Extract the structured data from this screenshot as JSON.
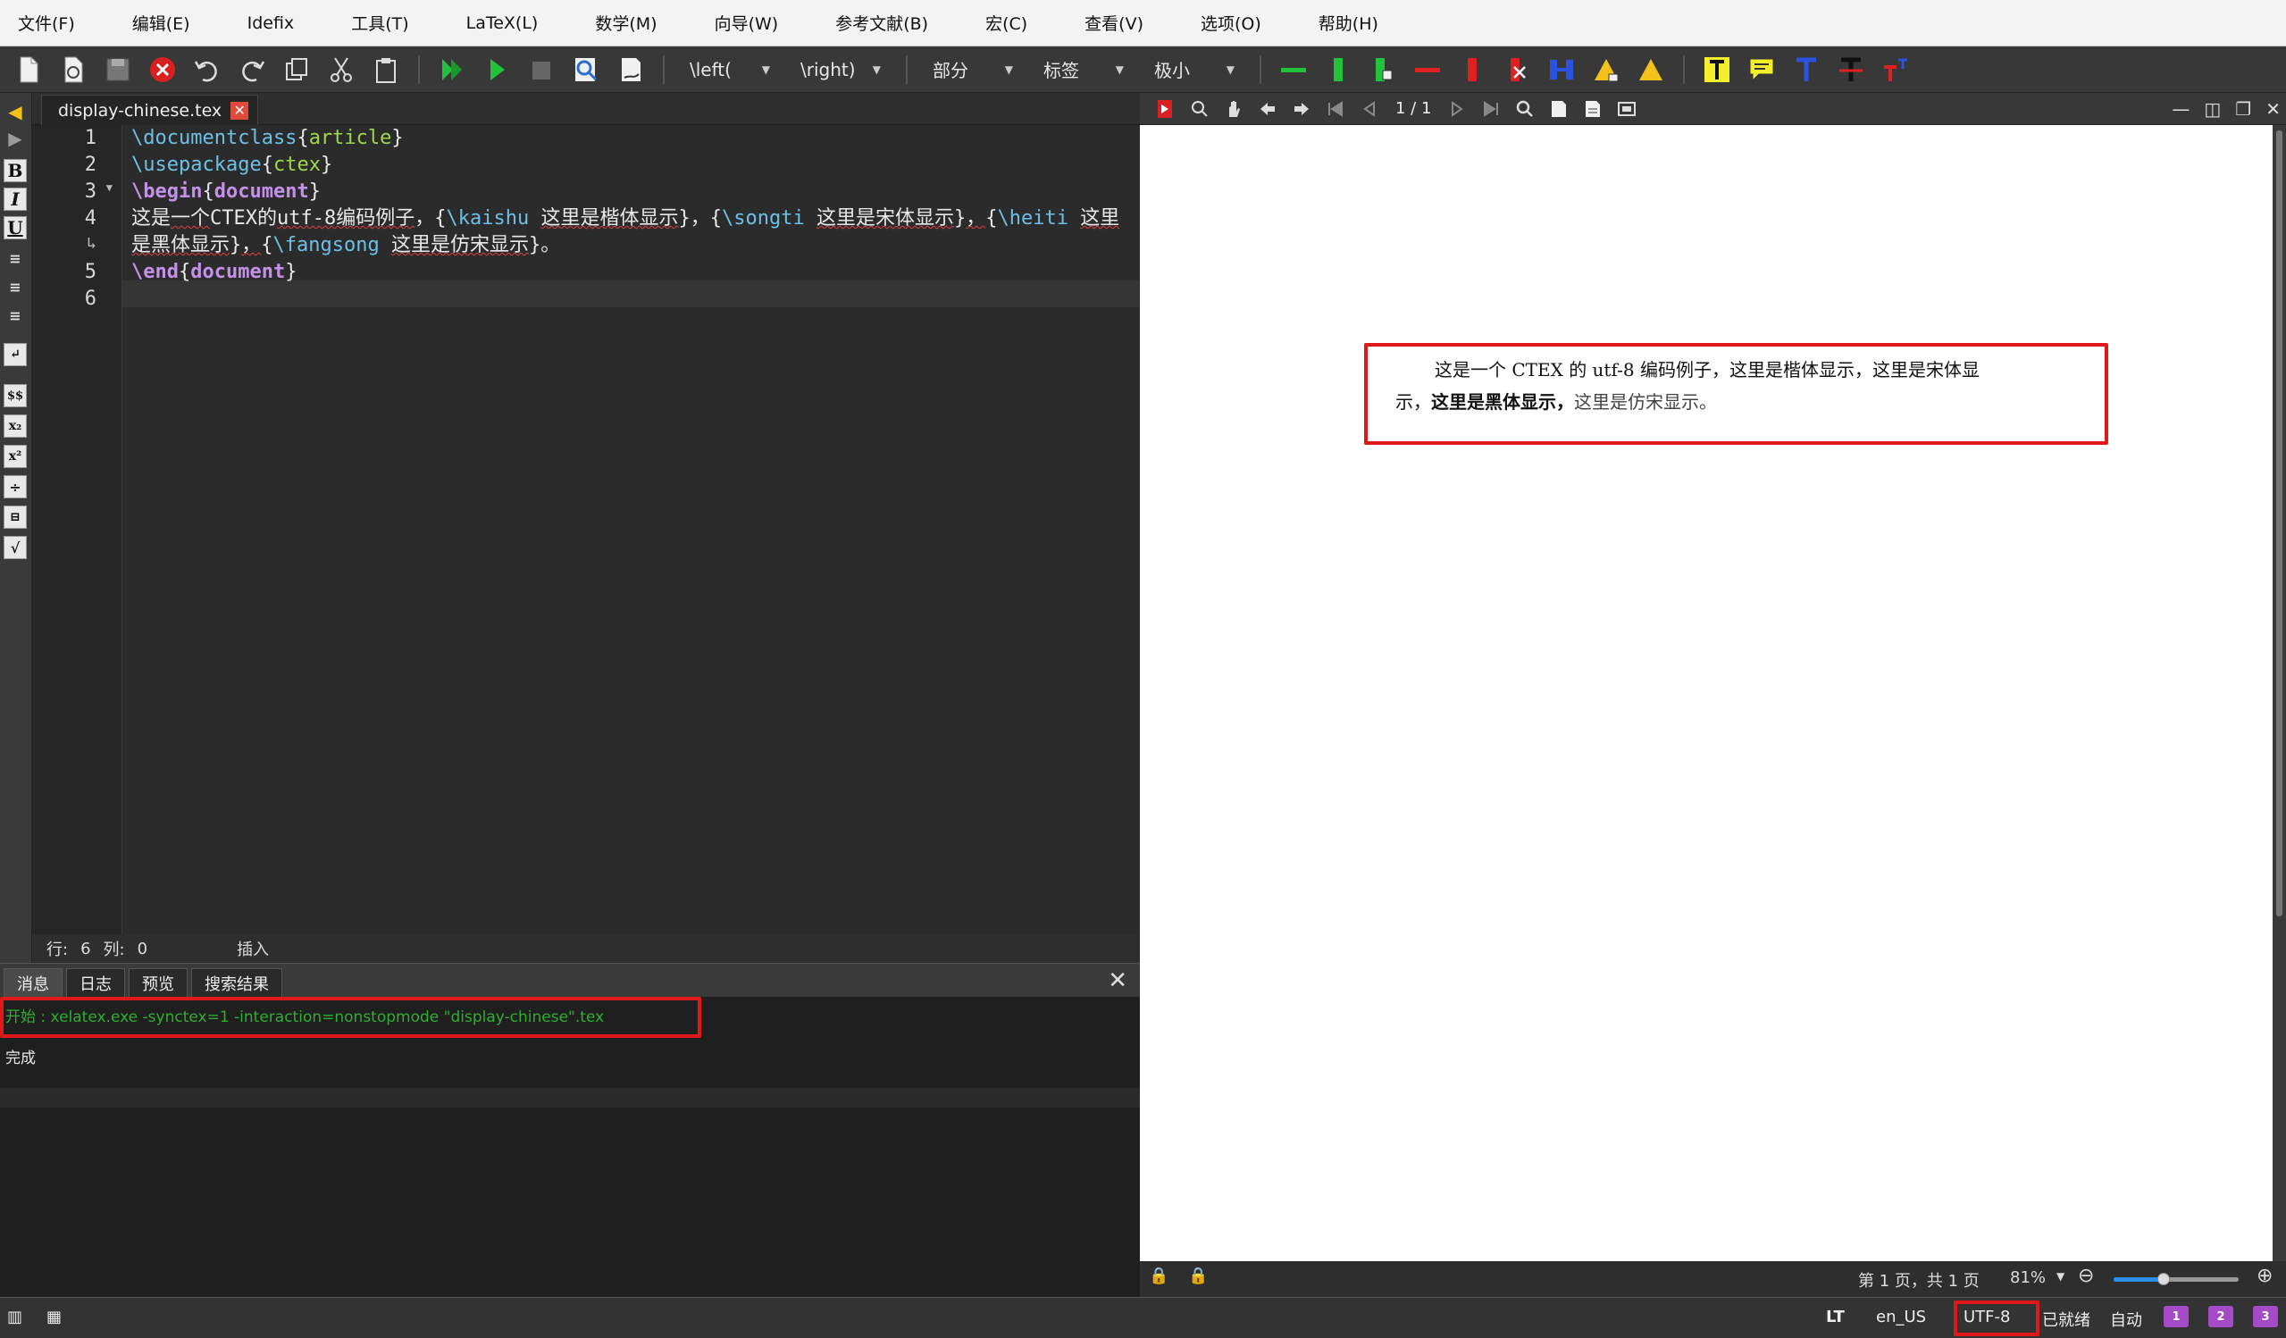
{
  "menu": [
    "文件(F)",
    "编辑(E)",
    "Idefix",
    "工具(T)",
    "LaTeX(L)",
    "数学(M)",
    "向导(W)",
    "参考文献(B)",
    "宏(C)",
    "查看(V)",
    "选项(O)",
    "帮助(H)"
  ],
  "toolbar": {
    "left_paren": "\\left(",
    "right_paren": "\\right)",
    "section": "部分",
    "label": "标签",
    "size": "极小"
  },
  "editor": {
    "tab_name": "display-chinese.tex",
    "tab_close": "✕",
    "line_numbers": [
      "1",
      "2",
      "3",
      "4",
      "",
      "5",
      "6"
    ],
    "status": {
      "row_label": "行:",
      "row_value": "6",
      "col_label": "列:",
      "col_value": "0",
      "mode": "插入"
    }
  },
  "log": {
    "tabs": [
      "消息",
      "日志",
      "预览",
      "搜索结果"
    ],
    "start_line": "开始 : xelatex.exe -synctex=1 -interaction=nonstopmode \"display-chinese\".tex",
    "done_line": "完成"
  },
  "viewer": {
    "page_indicator": "1 / 1",
    "pdf_line1_a": "这是一个 CTEX 的 utf-8 编码例子，",
    "pdf_line1_b": "这里是楷体显示，",
    "pdf_line1_c": "这里是宋体显",
    "pdf_line2_a": "示，",
    "pdf_line2_b": "这里是黑体显示，",
    "pdf_line2_c": "这里是仿宋显示。",
    "status_page": "第 1 页，共 1 页",
    "zoom": "81%",
    "zoom_level": 0.4
  },
  "statusbar": {
    "language": "en_US",
    "encoding": "UTF-8",
    "state": "已就绪",
    "auto": "自动",
    "badge1": "1",
    "badge2": "2",
    "badge3": "3"
  },
  "colors": {
    "accent_red": "#e01818",
    "log_green": "#2fae2f",
    "keyword": "#6cc0e8",
    "argument": "#9ed84a"
  }
}
